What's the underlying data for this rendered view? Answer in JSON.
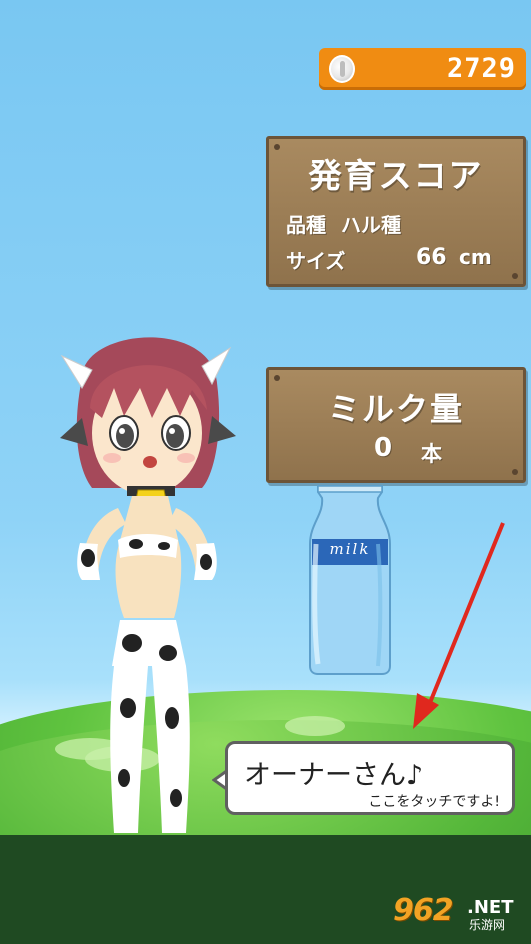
{
  "coins": {
    "value": "2729"
  },
  "score_board": {
    "title": "発育スコア",
    "breed_label": "品種",
    "breed_value": "ハル種",
    "size_label": "サイズ",
    "size_value": "66",
    "size_unit": "cm"
  },
  "milk_board": {
    "title": "ミルク量",
    "count": "0",
    "unit": "本"
  },
  "bottle": {
    "label": "milk"
  },
  "speech_bubble": {
    "main_text": "オーナーさん♪",
    "sub_text": "ここをタッチですよ!"
  },
  "watermark": {
    "logo": "962",
    "net": ".NET",
    "sub": "乐游网"
  },
  "colors": {
    "sky": "#79c7f2",
    "coin_bar": "#f08c12",
    "board_wood": "#a98a60",
    "ground": "#1f4a22",
    "arrow": "#e0281e"
  }
}
